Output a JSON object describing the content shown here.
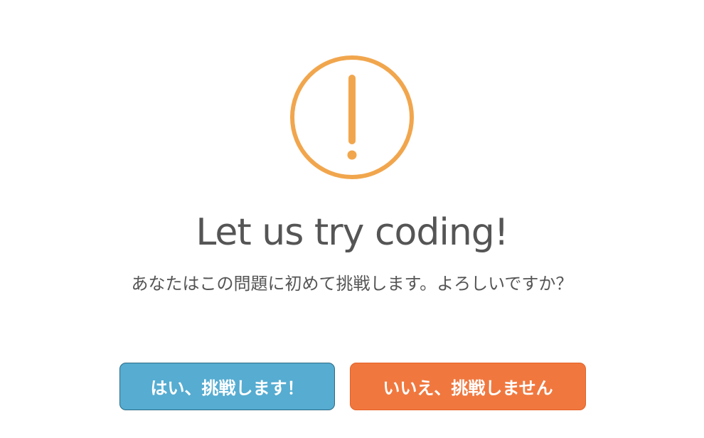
{
  "dialog": {
    "icon": "exclamation-circle-icon",
    "icon_color": "#f1a64d",
    "title": "Let us try coding!",
    "message": "あなたはこの問題に初めて挑戦します。よろしいですか？"
  },
  "buttons": {
    "confirm_label": "はい、挑戦します！",
    "confirm_color": "#56acd1",
    "cancel_label": "いいえ、挑戦しません",
    "cancel_color": "#f0783f"
  }
}
